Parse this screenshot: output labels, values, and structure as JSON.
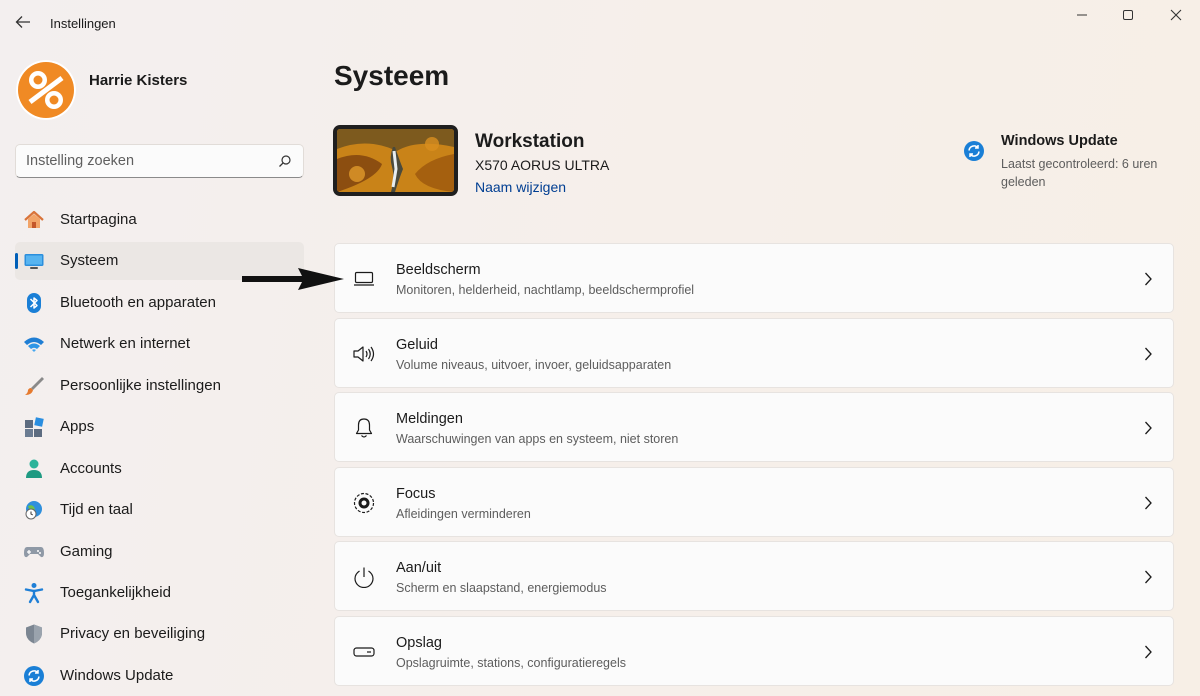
{
  "window": {
    "title": "Instellingen",
    "back_icon": "arrow-left-icon",
    "controls": [
      "minimize-icon",
      "maximize-icon",
      "close-icon"
    ]
  },
  "profile": {
    "name": "Harrie Kisters",
    "avatar_color": "#f08a24"
  },
  "search": {
    "placeholder": "Instelling zoeken",
    "value": ""
  },
  "sidebar": {
    "items": [
      {
        "label": "Startpagina",
        "icon": "home-icon",
        "active": false
      },
      {
        "label": "Systeem",
        "icon": "monitor-icon",
        "active": true
      },
      {
        "label": "Bluetooth en apparaten",
        "icon": "bluetooth-icon",
        "active": false
      },
      {
        "label": "Netwerk en internet",
        "icon": "wifi-icon",
        "active": false
      },
      {
        "label": "Persoonlijke instellingen",
        "icon": "brush-icon",
        "active": false
      },
      {
        "label": "Apps",
        "icon": "apps-icon",
        "active": false
      },
      {
        "label": "Accounts",
        "icon": "person-icon",
        "active": false
      },
      {
        "label": "Tijd en taal",
        "icon": "globe-clock-icon",
        "active": false
      },
      {
        "label": "Gaming",
        "icon": "gamepad-icon",
        "active": false
      },
      {
        "label": "Toegankelijkheid",
        "icon": "accessibility-icon",
        "active": false
      },
      {
        "label": "Privacy en beveiliging",
        "icon": "shield-icon",
        "active": false
      },
      {
        "label": "Windows Update",
        "icon": "sync-icon",
        "active": false
      }
    ]
  },
  "main": {
    "page_title": "Systeem",
    "device": {
      "name": "Workstation",
      "model": "X570 AORUS ULTRA",
      "rename_label": "Naam wijzigen"
    },
    "windows_update": {
      "title": "Windows Update",
      "status": "Laatst gecontroleerd: 6 uren geleden"
    },
    "cards": [
      {
        "title": "Beeldscherm",
        "description": "Monitoren, helderheid, nachtlamp, beeldschermprofiel",
        "icon": "display-icon"
      },
      {
        "title": "Geluid",
        "description": "Volume niveaus, uitvoer, invoer, geluidsapparaten",
        "icon": "speaker-icon"
      },
      {
        "title": "Meldingen",
        "description": "Waarschuwingen van apps en systeem, niet storen",
        "icon": "bell-icon"
      },
      {
        "title": "Focus",
        "description": "Afleidingen verminderen",
        "icon": "focus-icon"
      },
      {
        "title": "Aan/uit",
        "description": "Scherm en slaapstand, energiemodus",
        "icon": "power-icon"
      },
      {
        "title": "Opslag",
        "description": "Opslagruimte, stations, configuratieregels",
        "icon": "storage-icon"
      }
    ]
  },
  "annotation": {
    "arrow_icon": "pointer-arrow-icon"
  },
  "colors": {
    "accent": "#005fb8",
    "link": "#003e92",
    "orange": "#f08a24"
  }
}
